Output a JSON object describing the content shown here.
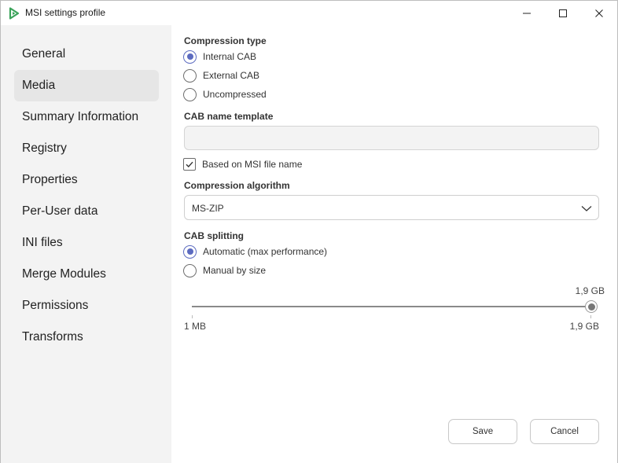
{
  "window": {
    "title": "MSI settings profile",
    "accent_color": "#5c6bc0",
    "icon": "advanced-installer-logo-icon"
  },
  "sidebar": {
    "items": [
      {
        "label": "General",
        "active": false
      },
      {
        "label": "Media",
        "active": true
      },
      {
        "label": "Summary Information",
        "active": false
      },
      {
        "label": "Registry",
        "active": false
      },
      {
        "label": "Properties",
        "active": false
      },
      {
        "label": "Per-User data",
        "active": false
      },
      {
        "label": "INI files",
        "active": false
      },
      {
        "label": "Merge Modules",
        "active": false
      },
      {
        "label": "Permissions",
        "active": false
      },
      {
        "label": "Transforms",
        "active": false
      }
    ]
  },
  "media": {
    "compression_type": {
      "label": "Compression type",
      "options": [
        {
          "label": "Internal CAB",
          "checked": true
        },
        {
          "label": "External CAB",
          "checked": false
        },
        {
          "label": "Uncompressed",
          "checked": false
        }
      ]
    },
    "cab_name_template": {
      "label": "CAB name template",
      "value": "",
      "placeholder": ""
    },
    "based_on_msi": {
      "label": "Based on MSI file name",
      "checked": true
    },
    "compression_algorithm": {
      "label": "Compression algorithm",
      "selected": "MS-ZIP"
    },
    "cab_splitting": {
      "label": "CAB splitting",
      "options": [
        {
          "label": "Automatic (max performance)",
          "checked": true
        },
        {
          "label": "Manual by size",
          "checked": false
        }
      ]
    },
    "slider": {
      "value_label": "1,9 GB",
      "min_label": "1 MB",
      "max_label": "1,9 GB",
      "fraction": 1.0
    }
  },
  "footer": {
    "save_label": "Save",
    "cancel_label": "Cancel"
  }
}
